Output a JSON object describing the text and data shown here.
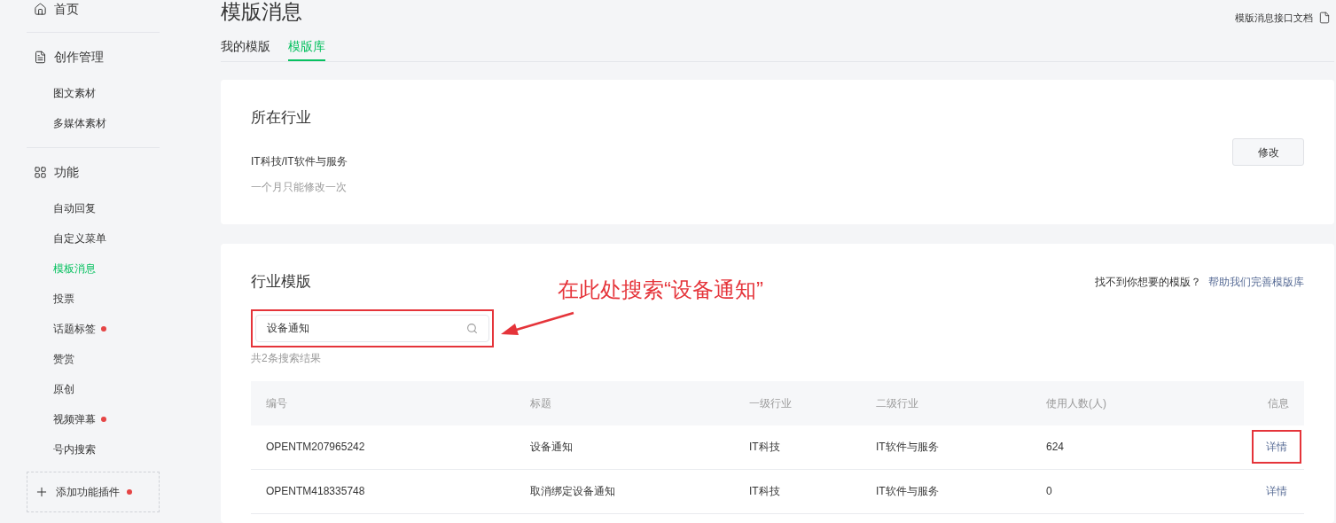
{
  "sidebar": {
    "sections": [
      {
        "label": "首页"
      },
      {
        "label": "创作管理",
        "children": [
          {
            "label": "图文素材",
            "selected": false,
            "dot": false
          },
          {
            "label": "多媒体素材",
            "selected": false,
            "dot": false
          }
        ]
      },
      {
        "label": "功能",
        "children": [
          {
            "label": "自动回复",
            "selected": false,
            "dot": false
          },
          {
            "label": "自定义菜单",
            "selected": false,
            "dot": false
          },
          {
            "label": "模板消息",
            "selected": true,
            "dot": false
          },
          {
            "label": "投票",
            "selected": false,
            "dot": false
          },
          {
            "label": "话题标签",
            "selected": false,
            "dot": true
          },
          {
            "label": "赞赏",
            "selected": false,
            "dot": false
          },
          {
            "label": "原创",
            "selected": false,
            "dot": false
          },
          {
            "label": "视频弹幕",
            "selected": false,
            "dot": true
          },
          {
            "label": "号内搜索",
            "selected": false,
            "dot": false
          }
        ]
      }
    ],
    "add_plugin": {
      "label": "添加功能插件",
      "dot": true
    }
  },
  "page": {
    "title": "模版消息",
    "doc_link": "模版消息接口文档"
  },
  "tabs": [
    {
      "label": "我的模版",
      "selected": false
    },
    {
      "label": "模版库",
      "selected": true
    }
  ],
  "industry_card": {
    "title": "所在行业",
    "industry": "IT科技/IT软件与服务",
    "note": "一个月只能修改一次",
    "button": "修改"
  },
  "templates_card": {
    "title": "行业模版",
    "help_text": "找不到你想要的模版？",
    "help_link": "帮助我们完善模版库",
    "search": {
      "value": "设备通知",
      "highlighted": true
    },
    "result_count": "共2条搜索结果",
    "table": {
      "columns": [
        "编号",
        "标题",
        "一级行业",
        "二级行业",
        "使用人数(人)",
        "信息"
      ],
      "rows": [
        {
          "cells": [
            "OPENTM207965242",
            "设备通知",
            "IT科技",
            "IT软件与服务",
            "624"
          ],
          "action": "详情",
          "highlighted": true
        },
        {
          "cells": [
            "OPENTM418335748",
            "取消绑定设备通知",
            "IT科技",
            "IT软件与服务",
            "0"
          ],
          "action": "详情",
          "highlighted": false
        }
      ]
    }
  },
  "annotation": {
    "text": "在此处搜索“设备通知”"
  }
}
